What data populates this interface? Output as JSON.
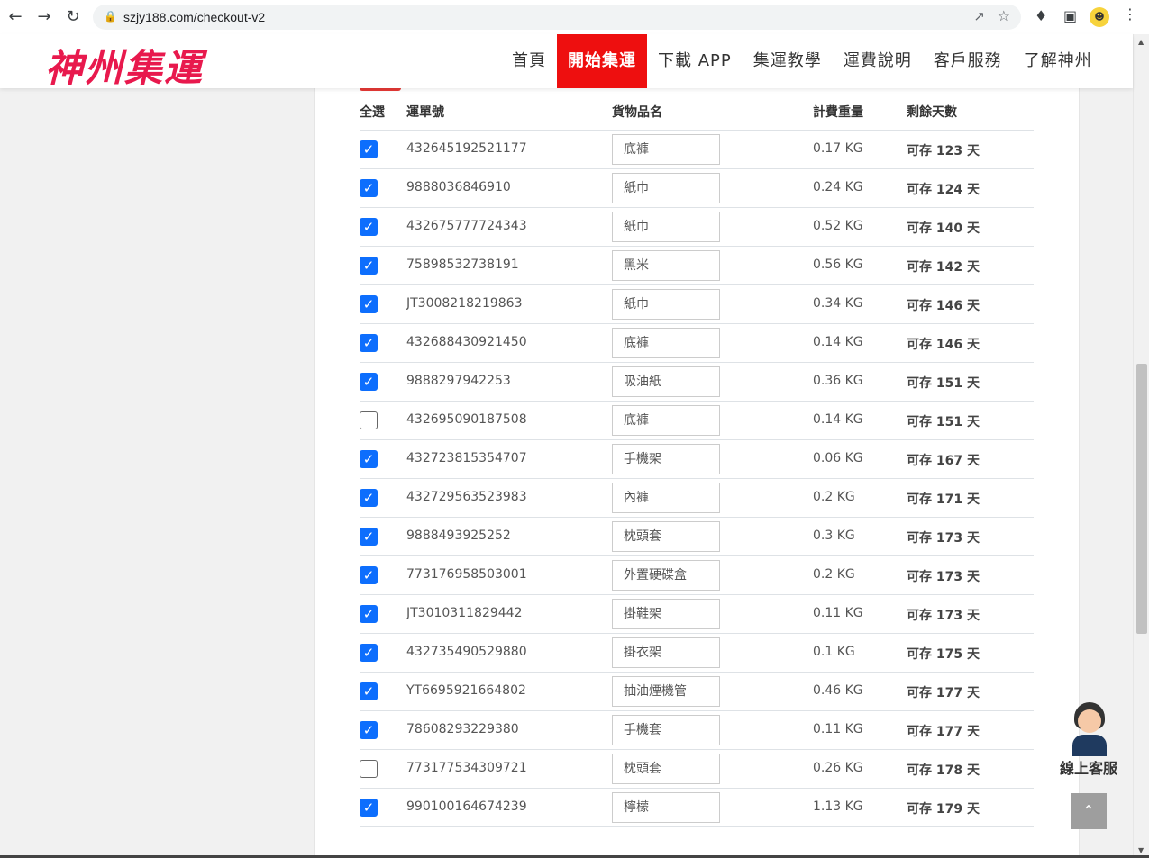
{
  "browser": {
    "url": "szjy188.com/checkout-v2"
  },
  "site": {
    "logo": "神州集運",
    "nav": [
      {
        "label": "首頁",
        "active": false
      },
      {
        "label": "開始集運",
        "active": true
      },
      {
        "label": "下載 APP",
        "active": false
      },
      {
        "label": "集運教學",
        "active": false
      },
      {
        "label": "運費說明",
        "active": false
      },
      {
        "label": "客戶服務",
        "active": false
      },
      {
        "label": "了解神州",
        "active": false
      }
    ]
  },
  "table": {
    "headers": {
      "select_all": "全選",
      "tracking": "運單號",
      "item_name": "貨物品名",
      "weight": "計費重量",
      "days": "剩餘天數"
    },
    "rows": [
      {
        "checked": true,
        "tracking": "432645192521177",
        "item": "底褲",
        "weight": "0.17 KG",
        "days": "可存 123 天"
      },
      {
        "checked": true,
        "tracking": "9888036846910",
        "item": "紙巾",
        "weight": "0.24 KG",
        "days": "可存 124 天"
      },
      {
        "checked": true,
        "tracking": "432675777724343",
        "item": "紙巾",
        "weight": "0.52 KG",
        "days": "可存 140 天"
      },
      {
        "checked": true,
        "tracking": "75898532738191",
        "item": "黑米",
        "weight": "0.56 KG",
        "days": "可存 142 天"
      },
      {
        "checked": true,
        "tracking": "JT3008218219863",
        "item": "紙巾",
        "weight": "0.34 KG",
        "days": "可存 146 天"
      },
      {
        "checked": true,
        "tracking": "432688430921450",
        "item": "底褲",
        "weight": "0.14 KG",
        "days": "可存 146 天"
      },
      {
        "checked": true,
        "tracking": "9888297942253",
        "item": "吸油紙",
        "weight": "0.36 KG",
        "days": "可存 151 天"
      },
      {
        "checked": false,
        "tracking": "432695090187508",
        "item": "底褲",
        "weight": "0.14 KG",
        "days": "可存 151 天"
      },
      {
        "checked": true,
        "tracking": "432723815354707",
        "item": "手機架",
        "weight": "0.06 KG",
        "days": "可存 167 天"
      },
      {
        "checked": true,
        "tracking": "432729563523983",
        "item": "內褲",
        "weight": "0.2 KG",
        "days": "可存 171 天"
      },
      {
        "checked": true,
        "tracking": "9888493925252",
        "item": "枕頭套",
        "weight": "0.3 KG",
        "days": "可存 173 天"
      },
      {
        "checked": true,
        "tracking": "773176958503001",
        "item": "外置硬碟盒",
        "weight": "0.2 KG",
        "days": "可存 173 天"
      },
      {
        "checked": true,
        "tracking": "JT3010311829442",
        "item": "掛鞋架",
        "weight": "0.11 KG",
        "days": "可存 173 天"
      },
      {
        "checked": true,
        "tracking": "432735490529880",
        "item": "掛衣架",
        "weight": "0.1 KG",
        "days": "可存 175 天"
      },
      {
        "checked": true,
        "tracking": "YT6695921664802",
        "item": "抽油煙機管",
        "weight": "0.46 KG",
        "days": "可存 177 天"
      },
      {
        "checked": true,
        "tracking": "78608293229380",
        "item": "手機套",
        "weight": "0.11 KG",
        "days": "可存 177 天"
      },
      {
        "checked": false,
        "tracking": "773177534309721",
        "item": "枕頭套",
        "weight": "0.26 KG",
        "days": "可存 178 天"
      },
      {
        "checked": true,
        "tracking": "990100164674239",
        "item": "檸檬",
        "weight": "1.13 KG",
        "days": "可存 179 天"
      }
    ]
  },
  "support": {
    "label": "線上客服"
  },
  "colors": {
    "brand": "#e8194d",
    "nav_active": "#ee0f0f",
    "checkbox": "#0d6efd"
  }
}
